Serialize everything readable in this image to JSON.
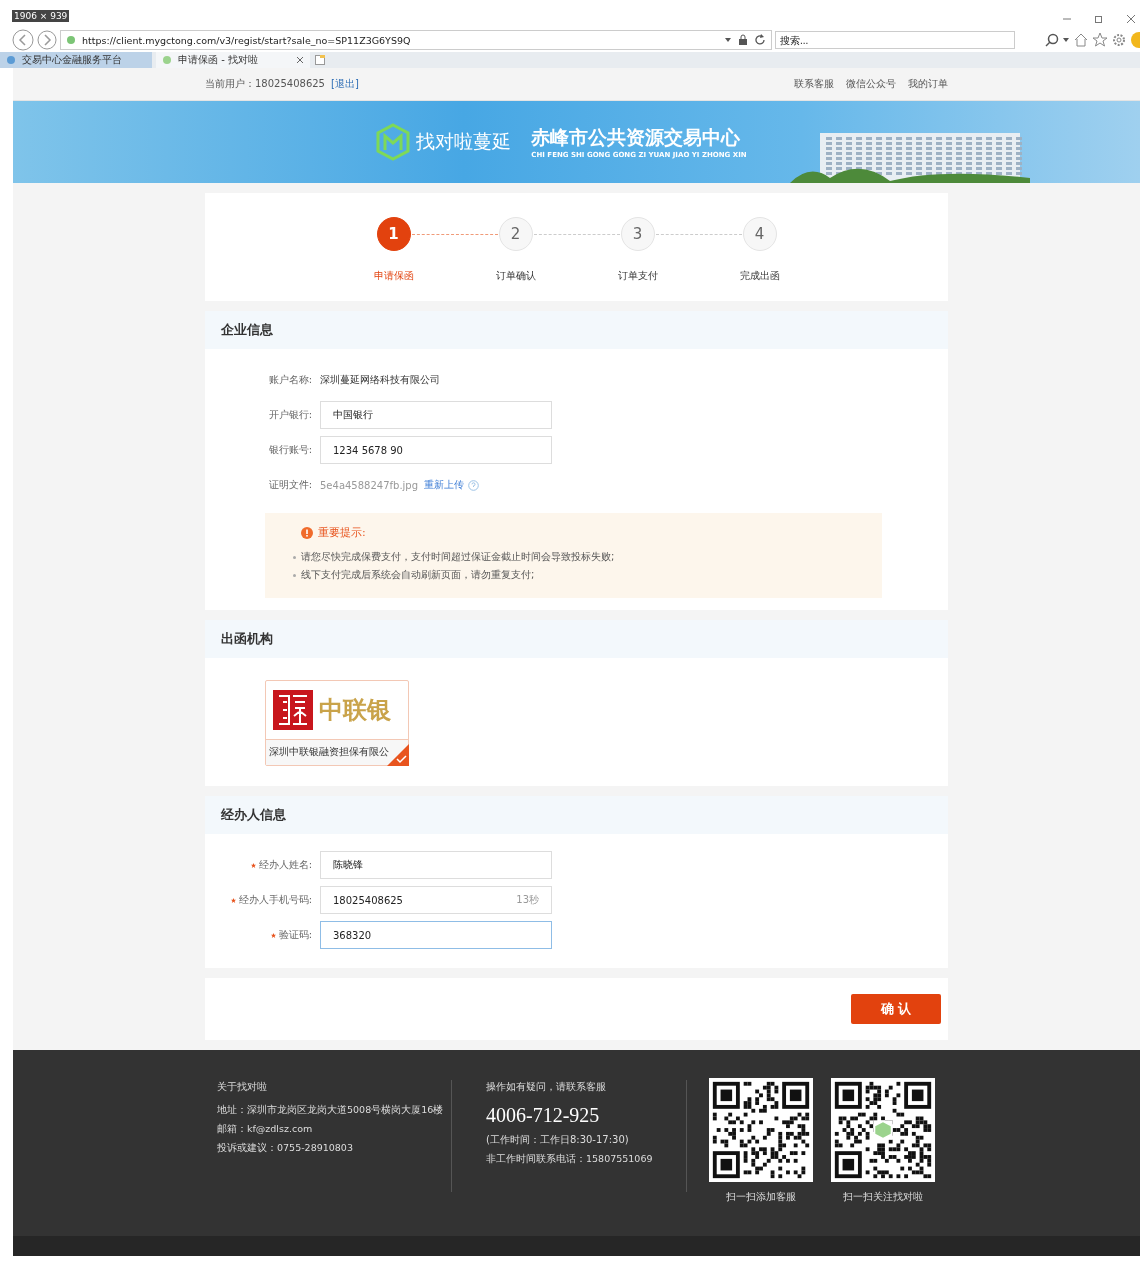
{
  "browser": {
    "size_label": "1906 × 939",
    "url": "https://client.mygctong.com/v3/regist/start?sale_no=SP11Z3G6YS9Q",
    "search_placeholder": "搜索...",
    "tabs": [
      {
        "label": "交易中心金融服务平台",
        "selected": false
      },
      {
        "label": "申请保函 - 找对啦",
        "selected": true
      }
    ]
  },
  "top_bar": {
    "user_label": "当前用户：18025408625",
    "logout": "[退出]",
    "links": [
      "联系客服",
      "微信公众号",
      "我的订单"
    ]
  },
  "banner": {
    "brand": "找对啦蔓延",
    "title": "赤峰市公共资源交易中心",
    "subtitle": "CHI FENG SHI GONG GONG ZI YUAN JIAO YI ZHONG XIN"
  },
  "steps": [
    {
      "number": "1",
      "label": "申请保函",
      "selected": true
    },
    {
      "number": "2",
      "label": "订单确认",
      "selected": false
    },
    {
      "number": "3",
      "label": "订单支付",
      "selected": false
    },
    {
      "number": "4",
      "label": "完成出函",
      "selected": false
    }
  ],
  "company": {
    "title": "企业信息",
    "fields": [
      {
        "kind": "text",
        "label": "账户名称:",
        "value": "深圳蔓延网络科技有限公司"
      },
      {
        "kind": "input",
        "label": "开户银行:",
        "value": "中国银行"
      },
      {
        "kind": "input",
        "label": "银行账号:",
        "value": "1234 5678 90"
      },
      {
        "kind": "file",
        "label": "证明文件:",
        "value": "5e4a4588247fb.jpg",
        "link": "重新上传"
      }
    ],
    "notice": {
      "title": "重要提示:",
      "items": [
        "请您尽快完成保费支付，支付时间超过保证金截止时间会导致投标失败;",
        "线下支付完成后系统会自动刷新页面，请勿重复支付;"
      ]
    }
  },
  "issuer": {
    "title": "出函机构",
    "options": [
      {
        "logo_text": "中联银",
        "name": "深圳中联银融资担保有限公",
        "selected": true
      }
    ]
  },
  "handler": {
    "title": "经办人信息",
    "fields": [
      {
        "label": "经办人姓名:",
        "required": true,
        "value": "陈晓锋",
        "focused": false
      },
      {
        "label": "经办人手机号码:",
        "required": true,
        "value": "18025408625",
        "suffix": "13秒",
        "focused": false
      },
      {
        "label": "验证码:",
        "required": true,
        "value": "368320",
        "focused": true
      }
    ]
  },
  "confirm_button": "确 认",
  "footer": {
    "about": {
      "title": "关于找对啦",
      "lines": [
        "地址：深圳市龙岗区龙岗大道5008号横岗大厦16楼",
        "邮箱：kf@zdlsz.com",
        "投诉或建议：0755-28910803"
      ]
    },
    "support": {
      "title": "操作如有疑问，请联系客服",
      "phone": "4006-712-925",
      "hours": "(工作时间：工作日8:30-17:30)",
      "after_hours": "非工作时间联系电话：15807551069"
    },
    "qr_codes": [
      {
        "caption": "扫一扫添加客服"
      },
      {
        "caption": "扫一扫关注找对啦"
      }
    ]
  }
}
